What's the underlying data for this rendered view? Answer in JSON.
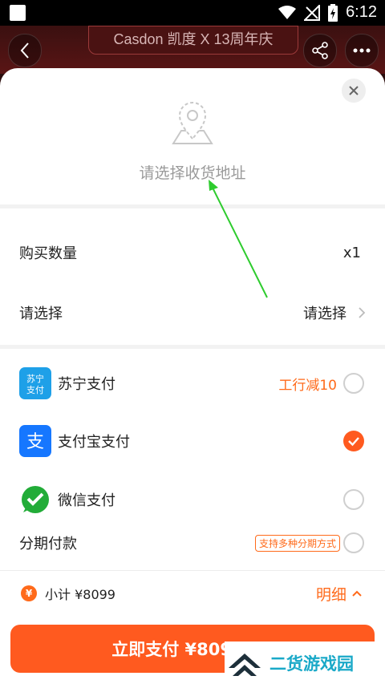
{
  "status_bar": {
    "time": "6:12"
  },
  "background": {
    "banner_text": "Casdon 凯度 X 13周年庆"
  },
  "address": {
    "placeholder_text": "请选择收货地址"
  },
  "quantity": {
    "label": "购买数量",
    "value": "x1"
  },
  "option": {
    "label": "请选择",
    "value": "请选择"
  },
  "payment_methods": [
    {
      "name": "苏宁支付",
      "logo_text": "苏宁\n支付",
      "promo": "工行减10",
      "checked": false
    },
    {
      "name": "支付宝支付",
      "logo_text": "支",
      "promo": "",
      "checked": true
    },
    {
      "name": "微信支付",
      "logo_text": "",
      "promo": "",
      "checked": false
    },
    {
      "name": "分期付款",
      "badge": "支持多种分期方式",
      "checked": false
    }
  ],
  "summary": {
    "coin_symbol": "¥",
    "subtotal": "小计 ¥8099",
    "detail_label": "明细"
  },
  "pay_button": {
    "label": "立即支付 ¥8099.00"
  },
  "watermark": {
    "text": "二货游戏园"
  },
  "colors": {
    "accent": "#ff5a1f",
    "annotation_arrow": "#2ecc2e"
  }
}
